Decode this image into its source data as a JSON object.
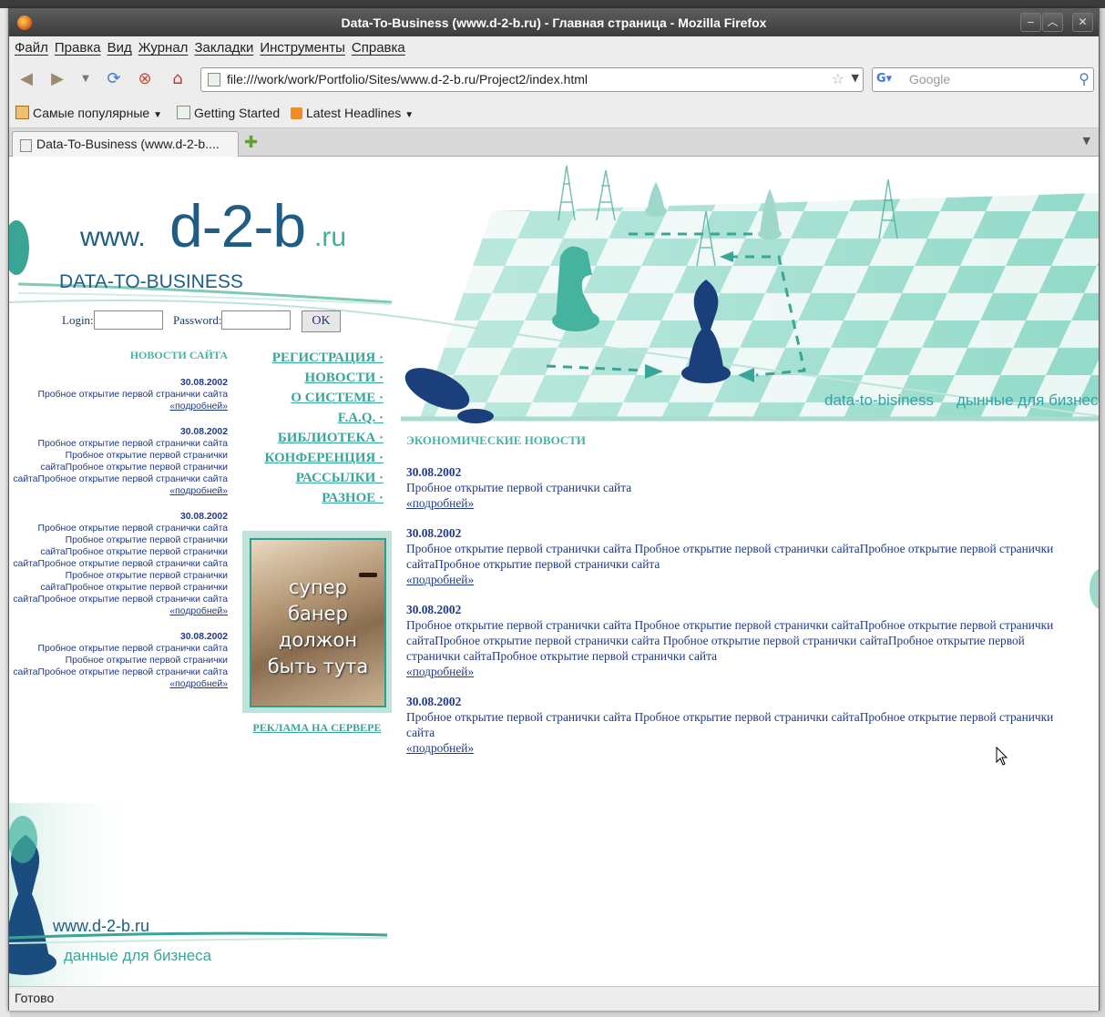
{
  "window": {
    "title": "Data-To-Business (www.d-2-b.ru) - Главная страница - Mozilla Firefox"
  },
  "menubar": [
    "Файл",
    "Правка",
    "Вид",
    "Журнал",
    "Закладки",
    "Инструменты",
    "Справка"
  ],
  "navbar": {
    "url": "file:///work/work/Portfolio/Sites/www.d-2-b.ru/Project2/index.html",
    "search_placeholder": "Google"
  },
  "bookmarks": [
    "Самые популярные",
    "Getting Started",
    "Latest Headlines"
  ],
  "tab": {
    "label": "Data-To-Business (www.d-2-b...."
  },
  "status": "Готово",
  "page": {
    "logo": {
      "www": "www.",
      "name": "d-2-b",
      "tld": ".ru",
      "subtitle": "DATA-TO-BUSINESS"
    },
    "login": {
      "login_label": "Login:",
      "password_label": "Password:",
      "ok": "OK"
    },
    "tagline": {
      "d2b": "data-to-bisiness",
      "ru": "дынные для бизнеса"
    },
    "left_news_title": "НОВОСТИ САЙТА",
    "left_news": [
      {
        "date": "30.08.2002",
        "text": "Пробное открытие первой странички сайта",
        "more": "«подробней»"
      },
      {
        "date": "30.08.2002",
        "text": "Пробное открытие первой странички сайта Пробное открытие первой странички сайтаПробное открытие первой странички сайтаПробное открытие первой странички сайта",
        "more": "«подробней»"
      },
      {
        "date": "30.08.2002",
        "text": "Пробное открытие первой странички сайта Пробное открытие первой странички сайтаПробное открытие первой странички сайтаПробное открытие первой странички сайта Пробное открытие первой странички сайтаПробное открытие первой странички сайтаПробное открытие первой странички сайта",
        "more": "«подробней»"
      },
      {
        "date": "30.08.2002",
        "text": "Пробное открытие первой странички сайта Пробное открытие первой странички сайтаПробное открытие первой странички сайта",
        "more": "«подробней»"
      }
    ],
    "menu": [
      "РЕГИСТРАЦИЯ ·",
      "НОВОСТИ ·",
      "О СИСТЕМЕ ·",
      "F.A.Q. ·",
      "БИБЛИОТЕКА ·",
      "КОНФЕРЕНЦИЯ ·",
      "РАССЫЛКИ ·",
      "РАЗНОЕ ·"
    ],
    "banner": {
      "lines": [
        "супер",
        "банер",
        "должон",
        "быть тута"
      ]
    },
    "banner_caption": "РЕКЛАМА НА СЕРВЕРЕ",
    "econ_title": "ЭКОНОМИЧЕСКИЕ НОВОСТИ",
    "econ_news": [
      {
        "date": "30.08.2002",
        "text": "Пробное открытие первой странички сайта",
        "more": "«подробней»"
      },
      {
        "date": "30.08.2002",
        "text": "Пробное открытие первой странички сайта Пробное открытие первой странички сайтаПробное открытие первой странички сайтаПробное открытие первой странички сайта",
        "more": "«подробней»"
      },
      {
        "date": "30.08.2002",
        "text": "Пробное открытие первой странички сайта Пробное открытие первой странички сайтаПробное открытие первой странички сайтаПробное открытие первой странички сайта Пробное открытие первой странички сайтаПробное открытие первой странички сайтаПробное открытие первой странички сайта",
        "more": "«подробней»"
      },
      {
        "date": "30.08.2002",
        "text": "Пробное открытие первой странички сайта Пробное открытие первой странички сайтаПробное открытие первой странички сайта",
        "more": "«подробней»"
      }
    ],
    "footer": {
      "www": "www.d-2-b.ru",
      "tagline": "данные для бизнеса"
    }
  }
}
